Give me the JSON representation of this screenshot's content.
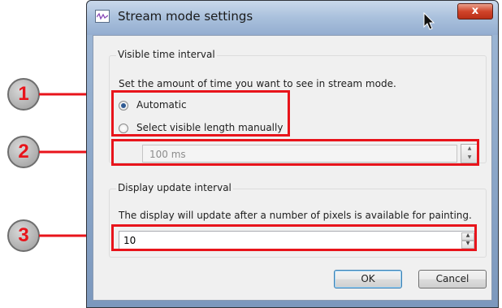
{
  "window": {
    "title": "Stream mode settings",
    "close_glyph": "x"
  },
  "visible_group": {
    "title": "Visible time interval",
    "description": "Set the amount of time you want to see in stream mode.",
    "options": [
      {
        "label": "Automatic",
        "checked": true
      },
      {
        "label": "Select visible length manually",
        "checked": false
      }
    ],
    "length_value": "100 ms"
  },
  "update_group": {
    "title": "Display update interval",
    "description": "The display will update after a number of pixels is available for painting.",
    "pixels_value": "10"
  },
  "buttons": {
    "ok": "OK",
    "cancel": "Cancel"
  },
  "callouts": [
    "1",
    "2",
    "3"
  ],
  "colors": {
    "highlight": "#e8141b",
    "title_bar": "#a9c0dc",
    "client_bg": "#f0f0f0"
  }
}
